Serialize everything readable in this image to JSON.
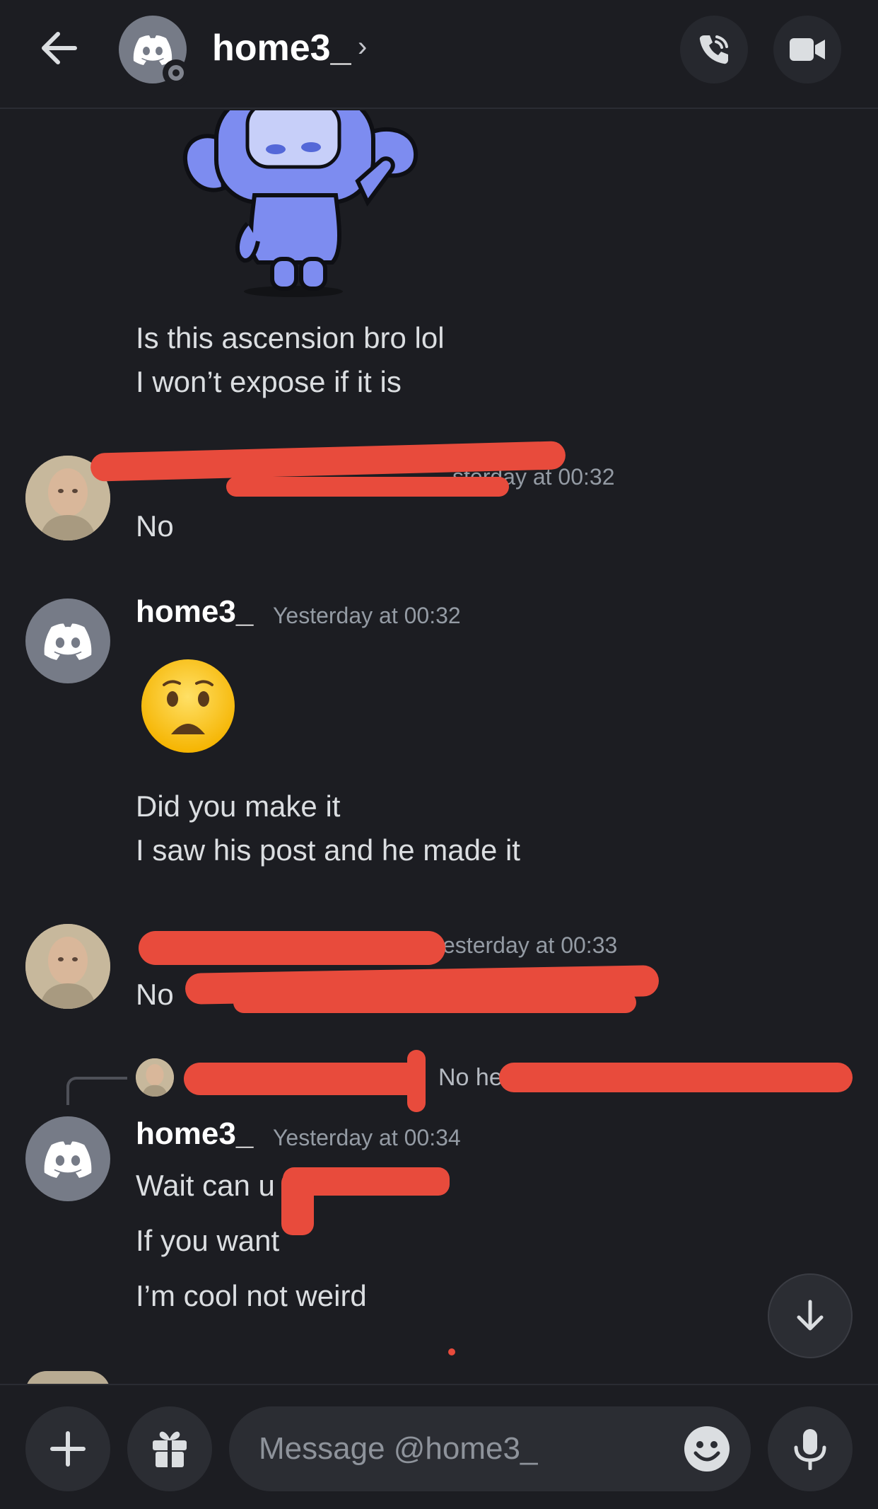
{
  "header": {
    "name": "home3_",
    "chevron": "›",
    "icons": [
      "back-arrow-icon",
      "discord-logo-icon",
      "phone-icon",
      "video-camera-icon"
    ]
  },
  "messages": {
    "sticker_caption_lines": [
      "Is this ascension bro lol",
      "I won’t expose if it is"
    ],
    "m1": {
      "timestamp_visible": "sterday at 00:32",
      "text": "No"
    },
    "m2": {
      "username": "home3_",
      "timestamp": "Yesterday at 00:32",
      "emoji": "😦",
      "lines": [
        "Did you make it",
        "I saw his post and he made it"
      ]
    },
    "m3": {
      "timestamp_visible": "esterday at 00:33",
      "text": "No"
    },
    "m4": {
      "reply_preview": "No he",
      "username": "home3_",
      "timestamp": "Yesterday at 00:34",
      "lines": [
        "Wait can u",
        "If you want",
        "I’m cool not weird"
      ]
    }
  },
  "composer": {
    "placeholder": "Message @home3_"
  },
  "colors": {
    "background": "#1c1d22",
    "surface": "#2b2d33",
    "redaction": "#e84b3c",
    "sticker_blue": "#7d8cf0"
  }
}
